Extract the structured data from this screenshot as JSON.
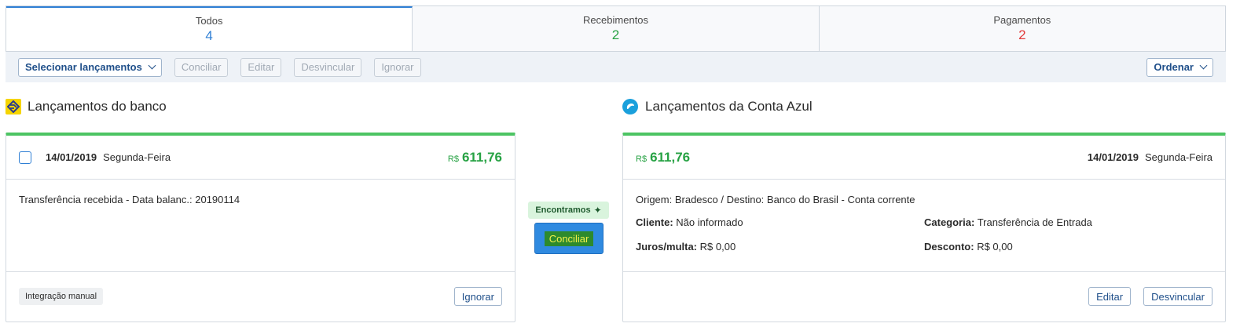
{
  "tabs": [
    {
      "label": "Todos",
      "count": "4",
      "color": "#2f7fd4"
    },
    {
      "label": "Recebimentos",
      "count": "2",
      "color": "#27a244"
    },
    {
      "label": "Pagamentos",
      "count": "2",
      "color": "#e23b3b"
    }
  ],
  "toolbar": {
    "select_label": "Selecionar lançamentos",
    "conciliar": "Conciliar",
    "editar": "Editar",
    "desvincular": "Desvincular",
    "ignorar": "Ignorar",
    "ordenar": "Ordenar"
  },
  "bank": {
    "title": "Lançamentos do banco",
    "date": "14/01/2019",
    "weekday": "Segunda-Feira",
    "currency": "R$",
    "amount": "611,76",
    "description": "Transferência recebida - Data balanc.: 20190114",
    "tag": "Integração manual",
    "ignore_label": "Ignorar"
  },
  "match": {
    "found_label": "Encontramos",
    "conciliar_label": "Conciliar"
  },
  "azul": {
    "title": "Lançamentos da Conta Azul",
    "currency": "R$",
    "amount": "611,76",
    "date": "14/01/2019",
    "weekday": "Segunda-Feira",
    "origin": "Origem: Bradesco / Destino: Banco do Brasil - Conta corrente",
    "cliente_label": "Cliente:",
    "cliente_value": "Não informado",
    "categoria_label": "Categoria:",
    "categoria_value": "Transferência de Entrada",
    "juros_label": "Juros/multa:",
    "juros_value": "R$ 0,00",
    "desconto_label": "Desconto:",
    "desconto_value": "R$ 0,00",
    "edit_label": "Editar",
    "unlink_label": "Desvincular"
  },
  "colors": {
    "accent": "#2f7fd4",
    "positive": "#27a244",
    "negative": "#e23b3b",
    "card_top": "#4cc463"
  }
}
